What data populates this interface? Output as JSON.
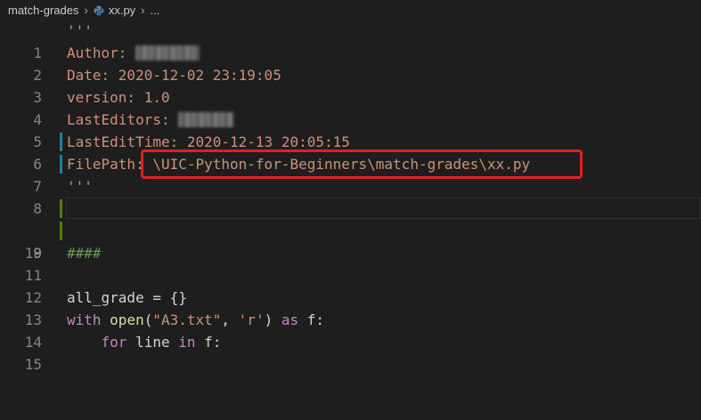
{
  "breadcrumb": {
    "folder": "match-grades",
    "file": "xx.py",
    "more": "..."
  },
  "colors": {
    "background": "#1e1e1e",
    "string": "#ce9178",
    "keyword": "#c586c0",
    "builtin": "#569cd6",
    "function": "#dcdcaa",
    "plain": "#d4d4d4",
    "comment": "#6a9955",
    "modified_marker": "#1b81a8",
    "added_marker": "#587c0c",
    "highlight_box": "#e02020"
  },
  "editor": {
    "lines": [
      {
        "n": "1",
        "tokens": [
          "'''"
        ]
      },
      {
        "n": "2",
        "tokens": [
          "Author: "
        ]
      },
      {
        "n": "3",
        "tokens": [
          "Date: 2020-12-02 23:19:05"
        ]
      },
      {
        "n": "4",
        "tokens": [
          "version: 1.0"
        ]
      },
      {
        "n": "5",
        "tokens": [
          "LastEditors: "
        ]
      },
      {
        "n": "6",
        "tokens": [
          "LastEditTime: 2020-12-13 20:05:15"
        ]
      },
      {
        "n": "7",
        "tokens": [
          "FilePath: \\UIC-Python-for-Beginners\\match-grades\\xx.py"
        ]
      },
      {
        "n": "8",
        "tokens": [
          "'''"
        ]
      },
      {
        "n": "9",
        "tokens": [
          ""
        ]
      },
      {
        "n": "10",
        "tokens": [
          ""
        ]
      },
      {
        "n": "11",
        "tokens": [
          "####"
        ]
      },
      {
        "n": "12",
        "tokens": [
          ""
        ]
      },
      {
        "n": "13",
        "tokens": [
          "all_grade",
          " = {}"
        ]
      },
      {
        "n": "14",
        "tokens": [
          "with",
          " ",
          "open",
          "(",
          "\"A3.txt\"",
          ", ",
          "'r'",
          ") ",
          "as",
          " f:"
        ]
      },
      {
        "n": "15",
        "tokens": [
          "    ",
          "for",
          " line ",
          "in",
          " f:"
        ]
      }
    ]
  }
}
